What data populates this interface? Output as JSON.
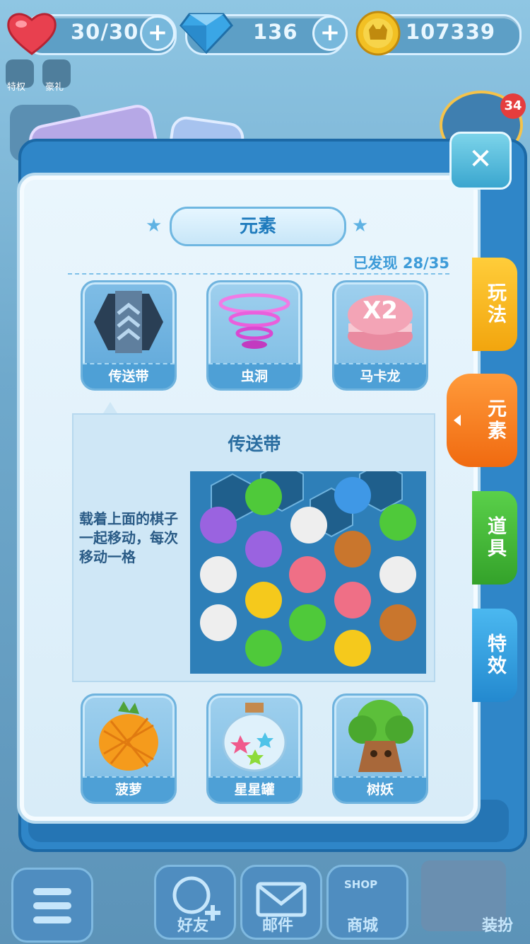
{
  "topbar": {
    "lives": "30/30",
    "gems": "136",
    "coins": "107339",
    "plus_label": "+"
  },
  "side": {
    "privilege_label": "特权",
    "gift_label": "豪礼",
    "badge_count": "34"
  },
  "panel": {
    "close_label": "✕",
    "title": "元素",
    "found_text": "已发现 28/35",
    "elements_top": [
      {
        "label": "传送带",
        "selected": true
      },
      {
        "label": "虫洞"
      },
      {
        "label": "马卡龙"
      }
    ],
    "macaron_mark": "X2",
    "detail": {
      "title": "传送带",
      "description": "载着上面的棋子一起移动，每次移动一格"
    },
    "elements_bottom": [
      {
        "label": "菠萝"
      },
      {
        "label": "星星罐"
      },
      {
        "label": "树妖"
      }
    ]
  },
  "tabs": [
    {
      "label": "玩法",
      "color": "#f7b21e"
    },
    {
      "label": "元素",
      "color": "#f77a1c",
      "selected": true
    },
    {
      "label": "道具",
      "color": "#45b83a"
    },
    {
      "label": "特效",
      "color": "#2f9ee0"
    }
  ],
  "bottom_bar": {
    "friends": "好友",
    "mail": "邮件",
    "shop_sign": "SHOP",
    "shop": "商城",
    "dressup": "装扮"
  },
  "colors": {
    "accent_blue": "#3d9bd8",
    "heart_red": "#e8404f",
    "gem_blue": "#3aa6e6",
    "coin_gold": "#f2c024"
  }
}
